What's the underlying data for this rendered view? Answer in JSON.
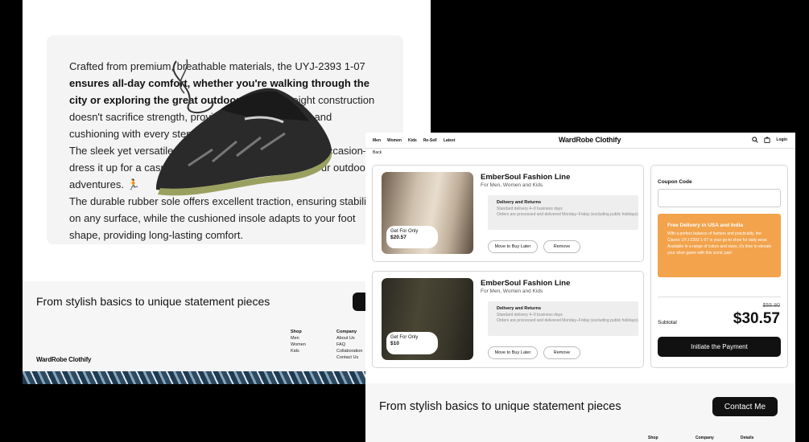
{
  "back_window": {
    "description_parts": [
      {
        "text": "Crafted from premium, breathable materials, the UYJ-2393 1-07 ",
        "bold": false
      },
      {
        "text": "ensures all-day comfort, whether you're walking through the city or exploring the great outdoors",
        "bold": true
      },
      {
        "text": ". Its lightweight construction doesn't sacrifice strength, providing superior support and cushioning with every step.",
        "bold": false
      },
      {
        "text": "\nThe sleek yet versatile design makes it perfect for any occasion—dress it up for a casual day out, or keep it sporty for your outdoor adventures. 🏃",
        "bold": false
      },
      {
        "text": "\nThe durable rubber sole offers excellent traction, ensuring stability on any surface, while the cushioned insole adapts to your foot shape, providing long-lasting comfort.",
        "bold": false
      }
    ],
    "footer": {
      "tagline": "From stylish basics to unique statement pieces",
      "logo": "WardRobe Clothify",
      "shop": {
        "title": "Shop",
        "items": [
          "Men",
          "Women",
          "Kids"
        ]
      },
      "company": {
        "title": "Company",
        "items": [
          "About Us",
          "FAQ",
          "Collaboration",
          "Contact Us"
        ]
      }
    }
  },
  "front_window": {
    "nav": {
      "links": [
        "Men",
        "Women",
        "Kids",
        "Re-Sell",
        "Latest"
      ],
      "logo": "WardRobe Clothify",
      "login": "Login"
    },
    "back_label": "Back",
    "cart_items": [
      {
        "title": "EmberSoul Fashion Line",
        "subtitle": "For Men, Women and Kids",
        "price_label": "Get For Only",
        "price": "$20.57",
        "delivery_title": "Delivery and Returns",
        "delivery_line1": "Standard delivery 4–9 business days",
        "delivery_line2": "Orders are processed and delivered Monday–Friday (excluding public holidays)",
        "later_label": "Move to Buy Later",
        "remove_label": "Remove"
      },
      {
        "title": "EmberSoul Fashion Line",
        "subtitle": "For Men, Women and Kids",
        "price_label": "Get For Only",
        "price": "$10",
        "delivery_title": "Delivery and Returns",
        "delivery_line1": "Standard delivery 4–9 business days",
        "delivery_line2": "Orders are processed and delivered Monday–Friday (excluding public holidays)",
        "later_label": "Move to Buy Later",
        "remove_label": "Remove"
      }
    ],
    "summary": {
      "coupon_label": "Coupon Code",
      "coupon_value": "",
      "promo_title": "Free Delivery in USA and India",
      "promo_body": "With a perfect balance of fashion and practicality, the Classic UYJ-2393 1-07 is your go-to shoe for daily wear. Available in a range of colors and sizes, it's time to elevate your shoe game with this iconic pair!",
      "old_price": "$55.80",
      "subtotal_label": "Subtotal",
      "total": "$30.57",
      "pay_label": "Initiate the Payment"
    },
    "footer": {
      "tagline": "From stylish basics to unique statement pieces",
      "contact_label": "Contact Me",
      "columns": [
        "Shop",
        "Company",
        "Details"
      ]
    }
  },
  "colors": {
    "promo": "#f2a34c",
    "primary_button": "#111111"
  }
}
